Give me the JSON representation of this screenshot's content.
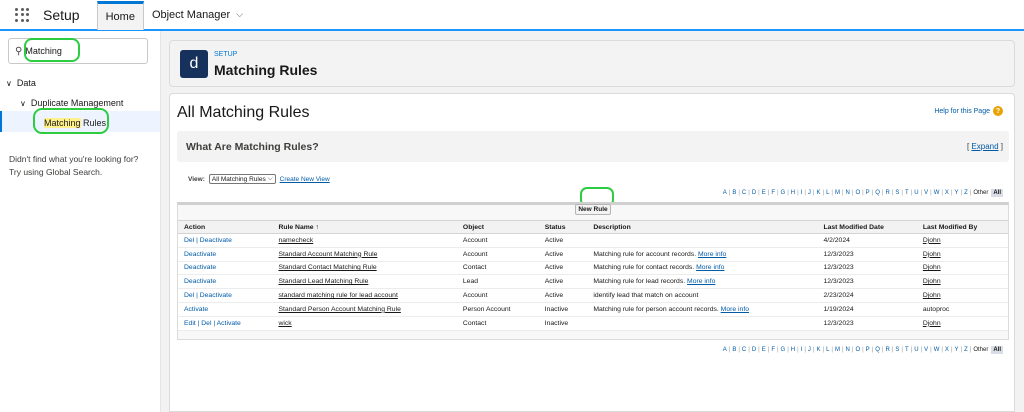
{
  "topbar": {
    "app_name": "Setup",
    "tabs": [
      {
        "label": "Home"
      },
      {
        "label": "Object Manager"
      }
    ]
  },
  "sidebar": {
    "search_value": "Matching",
    "tree": {
      "data": "Data",
      "dup": "Duplicate Management",
      "item_hl": "Matching",
      "item_rest": " Rules"
    },
    "help_line1": "Didn't find what you're looking for?",
    "help_line2": "Try using Global Search."
  },
  "header": {
    "icon_letter": "d",
    "eyebrow": "SETUP",
    "title": "Matching Rules"
  },
  "main": {
    "title": "All Matching Rules",
    "help_link": "Help for this Page",
    "help_icon": "?",
    "what_title": "What Are Matching Rules?",
    "expand_pre": "[ ",
    "expand": "Expand",
    "expand_post": " ]",
    "view_label": "View:",
    "view_value": "All Matching Rules",
    "create_view": "Create New View",
    "new_rule": "New Rule"
  },
  "alphabet": [
    "A",
    "B",
    "C",
    "D",
    "E",
    "F",
    "G",
    "H",
    "I",
    "J",
    "K",
    "L",
    "M",
    "N",
    "O",
    "P",
    "Q",
    "R",
    "S",
    "T",
    "U",
    "V",
    "W",
    "X",
    "Y",
    "Z"
  ],
  "alpha_other": "Other",
  "alpha_all": "All",
  "table": {
    "headers": [
      "Action",
      "Rule Name ↑",
      "Object",
      "Status",
      "Description",
      "Last Modified Date",
      "Last Modified By"
    ],
    "rows": [
      {
        "action": "Del | Deactivate",
        "name": "namecheck",
        "object": "Account",
        "status": "Active",
        "desc": "",
        "more": "",
        "date": "4/2/2024",
        "by": "Djohn"
      },
      {
        "action": "Deactivate",
        "name": "Standard Account Matching Rule",
        "object": "Account",
        "status": "Active",
        "desc": "Matching rule for account records.",
        "more": "More info",
        "date": "12/3/2023",
        "by": "Djohn"
      },
      {
        "action": "Deactivate",
        "name": "Standard Contact Matching Rule",
        "object": "Contact",
        "status": "Active",
        "desc": "Matching rule for contact records.",
        "more": "More info",
        "date": "12/3/2023",
        "by": "Djohn"
      },
      {
        "action": "Deactivate",
        "name": "Standard Lead Matching Rule",
        "object": "Lead",
        "status": "Active",
        "desc": "Matching rule for lead records.",
        "more": "More info",
        "date": "12/3/2023",
        "by": "Djohn"
      },
      {
        "action": "Del | Deactivate",
        "name": "standard matching rule for lead account",
        "object": "Account",
        "status": "Active",
        "desc": "identify lead that match on account",
        "more": "",
        "date": "2/23/2024",
        "by": "Djohn"
      },
      {
        "action": "Activate",
        "name": "Standard Person Account Matching Rule",
        "object": "Person Account",
        "status": "Inactive",
        "desc": "Matching rule for person account records.",
        "more": "More info",
        "date": "1/19/2024",
        "by": "autoproc"
      },
      {
        "action": "Edit | Del | Activate",
        "name": "wick",
        "object": "Contact",
        "status": "Inactive",
        "desc": "",
        "more": "",
        "date": "12/3/2023",
        "by": "Djohn"
      }
    ]
  }
}
